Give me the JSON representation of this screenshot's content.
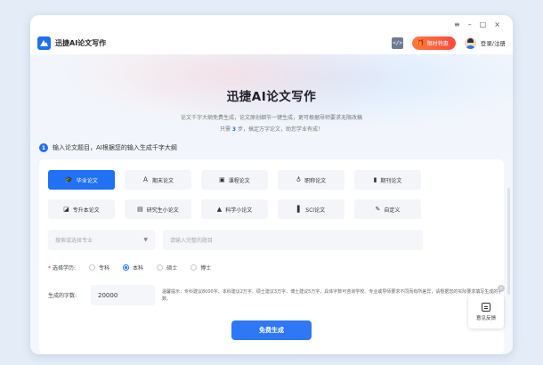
{
  "window_controls": {
    "menu": "≡",
    "minimize": "–",
    "maximize": "□",
    "close": "×"
  },
  "app": {
    "title": "迅捷AI论文写作"
  },
  "toolbar": {
    "code_icon": "</>",
    "promo_label": "限时特惠",
    "login_label": "登录/注册"
  },
  "hero": {
    "title": "迅捷AI论文写作",
    "subtitle_line1": "论文千字大纲免费生成，论文原创细节一键生成，更可根据导师要求无限改稿",
    "subtitle_line2_prefix": "只需",
    "subtitle_line2_num": "3",
    "subtitle_line2_suffix": "步，搞定万字论文，助您学业有成！"
  },
  "step": {
    "number": "1",
    "text": "输入论文题目，AI根据您的输入生成千字大纲"
  },
  "paper_types": [
    {
      "label": "毕业论文",
      "icon": "graduation-cap-icon",
      "glyph": "🎓"
    },
    {
      "label": "期末论文",
      "icon": "letter-a-icon",
      "glyph": "Ａ"
    },
    {
      "label": "课程论文",
      "icon": "book-icon",
      "glyph": "▣"
    },
    {
      "label": "职称论文",
      "icon": "medal-icon",
      "glyph": "♁"
    },
    {
      "label": "期刊论文",
      "icon": "journal-icon",
      "glyph": "▮"
    },
    {
      "label": "专升本论文",
      "icon": "doc-icon",
      "glyph": "◪"
    },
    {
      "label": "研究生小论文",
      "icon": "building-icon",
      "glyph": "▤"
    },
    {
      "label": "科学小论文",
      "icon": "flask-icon",
      "glyph": "▲"
    },
    {
      "label": "SCI论文",
      "icon": "sci-icon",
      "glyph": "▌"
    },
    {
      "label": "自定义",
      "icon": "pen-icon",
      "glyph": "✎"
    }
  ],
  "selected_type_index": 0,
  "fields": {
    "major_placeholder": "搜索或选择专业",
    "title_placeholder": "请输入完整的题目"
  },
  "degree": {
    "label": "选择学历:",
    "options": [
      "专科",
      "本科",
      "硕士",
      "博士"
    ],
    "selected": "本科"
  },
  "wordcount": {
    "label": "生成的字数:",
    "value": "20000",
    "tip": "温馨提示：专科建议8000字、本科建议2万字、硕士建议3万字、博士建议5万字，具体字数可咨询学校、专业或导师要求不同而有所差异，请根据您的实际要求填写生成的字数。"
  },
  "generate_label": "免费生成",
  "feedback": {
    "label": "意见反馈",
    "close": "×"
  },
  "colors": {
    "accent": "#2071f5",
    "promo": "#ff5a3d"
  }
}
